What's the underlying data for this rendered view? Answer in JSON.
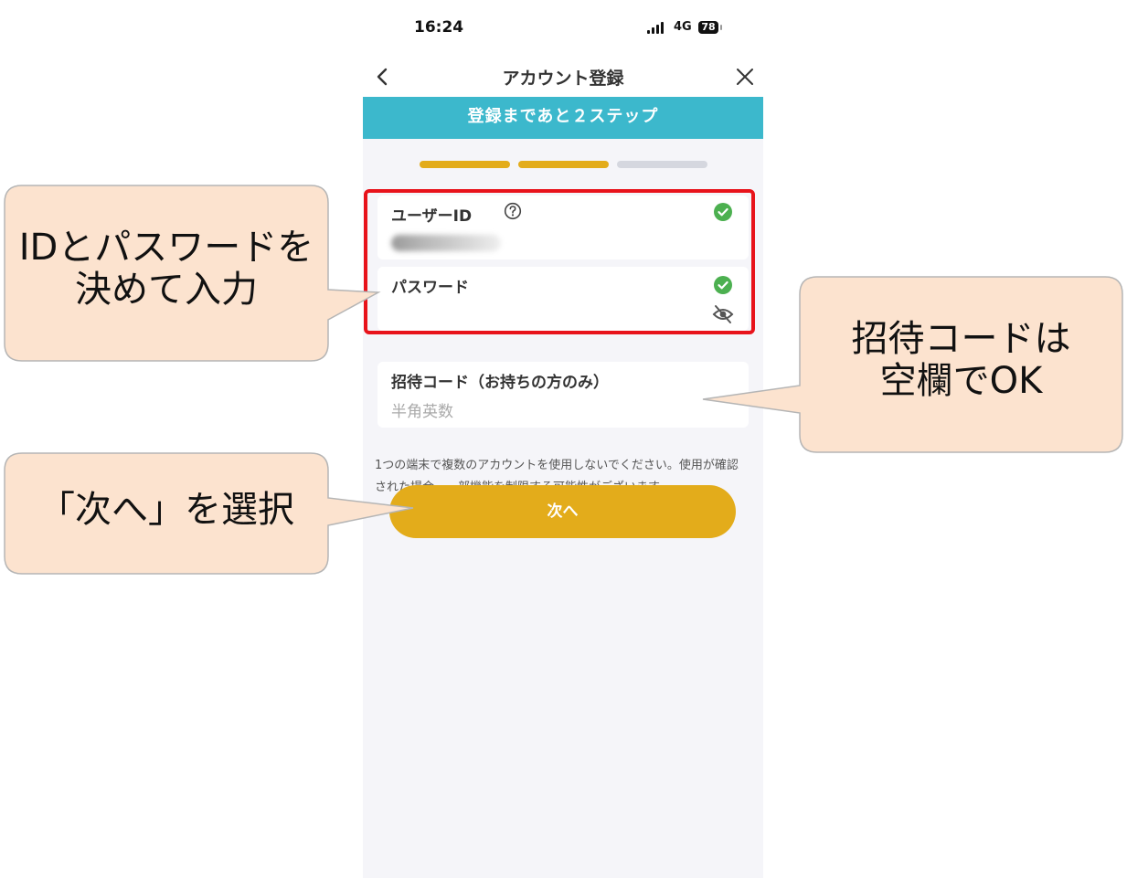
{
  "status_bar": {
    "time": "16:24",
    "network": "4G",
    "battery": "78"
  },
  "header": {
    "title": "アカウント登録"
  },
  "banner": {
    "text": "登録まであと２ステップ"
  },
  "progress": {
    "total_steps": 3,
    "completed_steps": 2,
    "active_color": "#e3ac1b",
    "inactive_color": "#d5d7df"
  },
  "fields": {
    "user_id": {
      "label": "ユーザーID"
    },
    "password": {
      "label": "パスワード"
    },
    "invite_code": {
      "label": "招待コード（お持ちの方のみ）",
      "placeholder": "半角英数"
    }
  },
  "notice": "1つの端末で複数のアカウントを使用しないでください。使用が確認された場合、一部機能を制限する可能性がございます。",
  "next_button": {
    "label": "次へ"
  },
  "callouts": {
    "id_password": [
      "IDとパスワードを",
      "決めて入力"
    ],
    "invite_code": [
      "招待コードは",
      "空欄でOK"
    ],
    "next": [
      "「次へ」を選択"
    ]
  },
  "colors": {
    "banner": "#3cb8cc",
    "button": "#e3ac1b",
    "highlight": "#e8131b",
    "callout_fill": "#fce3cf",
    "check": "#4cb050"
  }
}
